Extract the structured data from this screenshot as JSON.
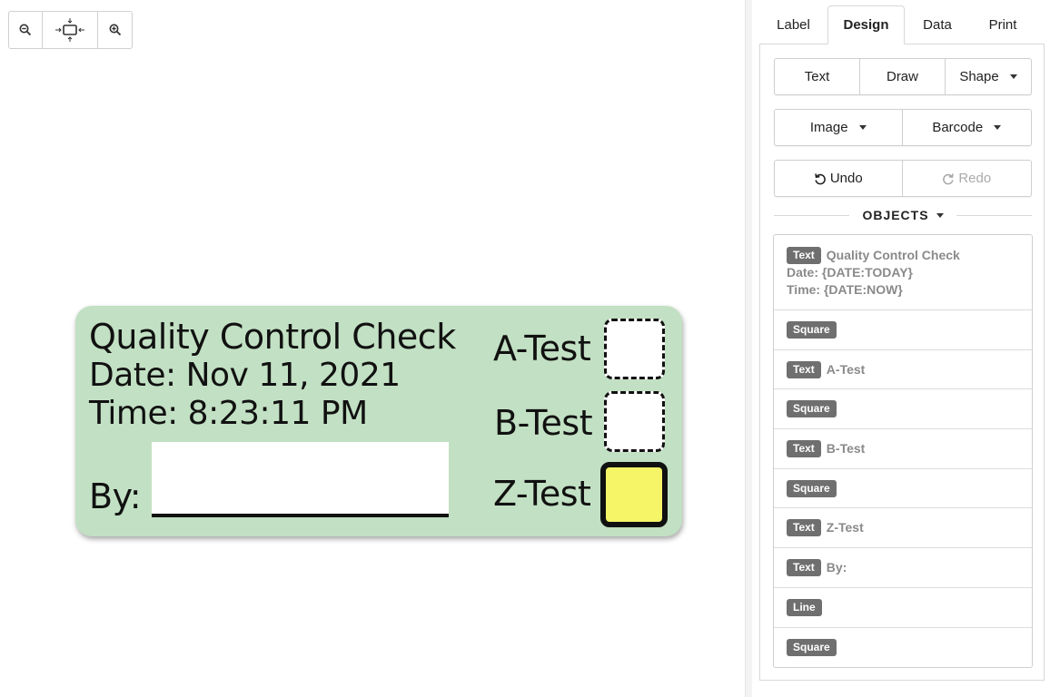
{
  "canvas": {
    "zoom": {
      "zoom_out_icon": "zoom-out-icon",
      "fit_icon": "fit-to-screen-icon",
      "zoom_in_icon": "zoom-in-icon"
    },
    "label": {
      "background": "#c2e0c3",
      "title": "Quality Control Check",
      "date": "Date: Nov 11, 2021",
      "time": "Time: 8:23:11 PM",
      "by": "By:",
      "a_test": "A-Test",
      "b_test": "B-Test",
      "z_test": "Z-Test",
      "z_fill": "#f6f567"
    }
  },
  "panel": {
    "tabs": [
      {
        "label": "Label"
      },
      {
        "label": "Design",
        "active": true
      },
      {
        "label": "Data"
      },
      {
        "label": "Print"
      }
    ],
    "toolbar": {
      "text": "Text",
      "draw": "Draw",
      "shape": "Shape",
      "image": "Image",
      "barcode": "Barcode",
      "undo": "Undo",
      "redo": "Redo"
    },
    "objects_title": "OBJECTS",
    "objects": [
      {
        "type": "Text",
        "text": "Quality Control Check",
        "lines": [
          "Date: {DATE:TODAY}",
          "Time: {DATE:NOW}"
        ]
      },
      {
        "type": "Square",
        "text": ""
      },
      {
        "type": "Text",
        "text": "A-Test"
      },
      {
        "type": "Square",
        "text": ""
      },
      {
        "type": "Text",
        "text": "B-Test"
      },
      {
        "type": "Square",
        "text": ""
      },
      {
        "type": "Text",
        "text": "Z-Test"
      },
      {
        "type": "Text",
        "text": "By:"
      },
      {
        "type": "Line",
        "text": ""
      },
      {
        "type": "Square",
        "text": ""
      }
    ]
  }
}
